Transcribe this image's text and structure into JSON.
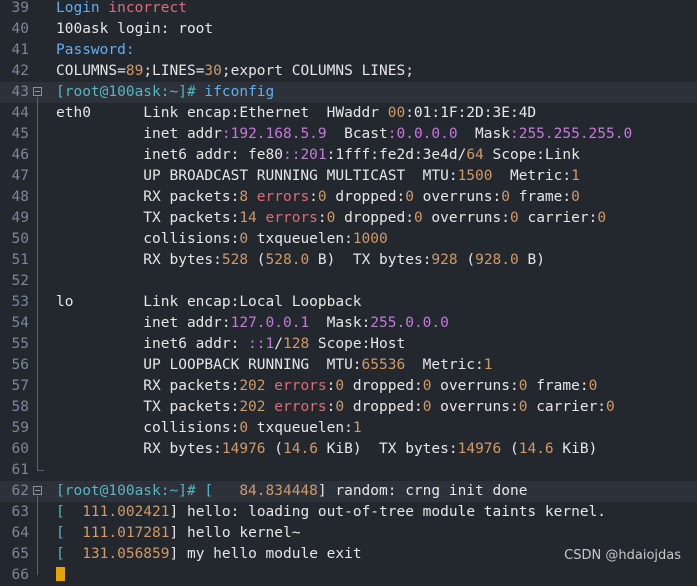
{
  "watermark": "CSDN @hdaiojdas",
  "lines": [
    {
      "n": "39",
      "fold": false,
      "hl": false,
      "segs": [
        [
          "Login ",
          "cyan"
        ],
        [
          "incorrect",
          "red"
        ]
      ]
    },
    {
      "n": "40",
      "fold": false,
      "hl": false,
      "segs": [
        [
          "100ask ",
          ""
        ],
        [
          "login",
          ""
        ],
        [
          ": root",
          ""
        ]
      ]
    },
    {
      "n": "41",
      "fold": false,
      "hl": false,
      "segs": [
        [
          "Password:",
          "cyan"
        ]
      ]
    },
    {
      "n": "42",
      "fold": false,
      "hl": false,
      "segs": [
        [
          "COLUMNS=",
          ""
        ],
        [
          "89",
          "orange"
        ],
        [
          ";LINES=",
          ""
        ],
        [
          "30",
          "orange"
        ],
        [
          ";export COLUMNS LINES;",
          ""
        ]
      ]
    },
    {
      "n": "43",
      "fold": true,
      "hl": true,
      "segs": [
        [
          "[root@100ask:~]#",
          "prompt"
        ],
        [
          " ifconfig",
          "cyan"
        ]
      ]
    },
    {
      "n": "44",
      "fold": false,
      "hl": false,
      "segs": [
        [
          "eth0      Link encap:Ethernet  HWaddr ",
          ""
        ],
        [
          "00",
          "orange"
        ],
        [
          ":01:1F:2D:3E:4D",
          ""
        ]
      ]
    },
    {
      "n": "45",
      "fold": false,
      "hl": false,
      "segs": [
        [
          "          inet addr",
          ""
        ],
        [
          ":192.168.5.9",
          "purple"
        ],
        [
          "  Bcast",
          ""
        ],
        [
          ":0.0.0.0",
          "purple"
        ],
        [
          "  Mask",
          ""
        ],
        [
          ":255.255.255.0",
          "purple"
        ]
      ]
    },
    {
      "n": "46",
      "fold": false,
      "hl": false,
      "segs": [
        [
          "          inet6 addr: fe80",
          ""
        ],
        [
          "::201",
          "purple"
        ],
        [
          ":1fff:fe2d:3e4d/",
          ""
        ],
        [
          "64",
          "orange"
        ],
        [
          " Scope:Link",
          ""
        ]
      ]
    },
    {
      "n": "47",
      "fold": false,
      "hl": false,
      "segs": [
        [
          "          UP BROADCAST RUNNING MULTICAST  MTU:",
          ""
        ],
        [
          "1500",
          "orange"
        ],
        [
          "  Metric:",
          ""
        ],
        [
          "1",
          "orange"
        ]
      ]
    },
    {
      "n": "48",
      "fold": false,
      "hl": false,
      "segs": [
        [
          "          RX packets:",
          ""
        ],
        [
          "8",
          "orange"
        ],
        [
          " errors",
          "red"
        ],
        [
          ":",
          ""
        ],
        [
          "0",
          "orange"
        ],
        [
          " dropped:",
          ""
        ],
        [
          "0",
          "orange"
        ],
        [
          " overruns:",
          ""
        ],
        [
          "0",
          "orange"
        ],
        [
          " frame:",
          ""
        ],
        [
          "0",
          "orange"
        ]
      ]
    },
    {
      "n": "49",
      "fold": false,
      "hl": false,
      "segs": [
        [
          "          TX packets:",
          ""
        ],
        [
          "14",
          "orange"
        ],
        [
          " errors",
          "red"
        ],
        [
          ":",
          ""
        ],
        [
          "0",
          "orange"
        ],
        [
          " dropped:",
          ""
        ],
        [
          "0",
          "orange"
        ],
        [
          " overruns:",
          ""
        ],
        [
          "0",
          "orange"
        ],
        [
          " carrier:",
          ""
        ],
        [
          "0",
          "orange"
        ]
      ]
    },
    {
      "n": "50",
      "fold": false,
      "hl": false,
      "segs": [
        [
          "          collisions:",
          ""
        ],
        [
          "0",
          "orange"
        ],
        [
          " txqueuelen:",
          ""
        ],
        [
          "1000",
          "orange"
        ]
      ]
    },
    {
      "n": "51",
      "fold": false,
      "hl": false,
      "segs": [
        [
          "          RX bytes:",
          ""
        ],
        [
          "528",
          "orange"
        ],
        [
          " (",
          ""
        ],
        [
          "528.0",
          "orange"
        ],
        [
          " B)  TX bytes:",
          ""
        ],
        [
          "928",
          "orange"
        ],
        [
          " (",
          ""
        ],
        [
          "928.0",
          "orange"
        ],
        [
          " B)",
          ""
        ]
      ]
    },
    {
      "n": "52",
      "fold": false,
      "hl": false,
      "segs": []
    },
    {
      "n": "53",
      "fold": false,
      "hl": false,
      "segs": [
        [
          "lo        Link encap:Local Loopback",
          ""
        ]
      ]
    },
    {
      "n": "54",
      "fold": false,
      "hl": false,
      "segs": [
        [
          "          inet addr:",
          ""
        ],
        [
          "127.0.0.1",
          "purple"
        ],
        [
          "  Mask:",
          ""
        ],
        [
          "255.0.0.0",
          "purple"
        ]
      ]
    },
    {
      "n": "55",
      "fold": false,
      "hl": false,
      "segs": [
        [
          "          inet6 addr: ",
          ""
        ],
        [
          "::1",
          "purple"
        ],
        [
          "/",
          ""
        ],
        [
          "128",
          "orange"
        ],
        [
          " Scope:Host",
          ""
        ]
      ]
    },
    {
      "n": "56",
      "fold": false,
      "hl": false,
      "segs": [
        [
          "          UP LOOPBACK RUNNING  MTU:",
          ""
        ],
        [
          "65536",
          "orange"
        ],
        [
          "  Metric:",
          ""
        ],
        [
          "1",
          "orange"
        ]
      ]
    },
    {
      "n": "57",
      "fold": false,
      "hl": false,
      "segs": [
        [
          "          RX packets:",
          ""
        ],
        [
          "202",
          "orange"
        ],
        [
          " errors",
          "red"
        ],
        [
          ":",
          ""
        ],
        [
          "0",
          "orange"
        ],
        [
          " dropped:",
          ""
        ],
        [
          "0",
          "orange"
        ],
        [
          " overruns:",
          ""
        ],
        [
          "0",
          "orange"
        ],
        [
          " frame:",
          ""
        ],
        [
          "0",
          "orange"
        ]
      ]
    },
    {
      "n": "58",
      "fold": false,
      "hl": false,
      "segs": [
        [
          "          TX packets:",
          ""
        ],
        [
          "202",
          "orange"
        ],
        [
          " errors",
          "red"
        ],
        [
          ":",
          ""
        ],
        [
          "0",
          "orange"
        ],
        [
          " dropped:",
          ""
        ],
        [
          "0",
          "orange"
        ],
        [
          " overruns:",
          ""
        ],
        [
          "0",
          "orange"
        ],
        [
          " carrier:",
          ""
        ],
        [
          "0",
          "orange"
        ]
      ]
    },
    {
      "n": "59",
      "fold": false,
      "hl": false,
      "segs": [
        [
          "          collisions:",
          ""
        ],
        [
          "0",
          "orange"
        ],
        [
          " txqueuelen:",
          ""
        ],
        [
          "1",
          "orange"
        ]
      ]
    },
    {
      "n": "60",
      "fold": false,
      "hl": false,
      "segs": [
        [
          "          RX bytes:",
          ""
        ],
        [
          "14976",
          "orange"
        ],
        [
          " (",
          ""
        ],
        [
          "14.6",
          "orange"
        ],
        [
          " KiB)  TX bytes:",
          ""
        ],
        [
          "14976",
          "orange"
        ],
        [
          " (",
          ""
        ],
        [
          "14.6",
          "orange"
        ],
        [
          " KiB)",
          ""
        ]
      ]
    },
    {
      "n": "61",
      "fold": false,
      "hl": false,
      "segs": []
    },
    {
      "n": "62",
      "fold": true,
      "hl": true,
      "segs": [
        [
          "[root@100ask:~]# [   ",
          "prompt"
        ],
        [
          "84.834448",
          "orange"
        ],
        [
          "] random: crng init done",
          ""
        ]
      ]
    },
    {
      "n": "63",
      "fold": false,
      "hl": false,
      "segs": [
        [
          "[  ",
          "prompt"
        ],
        [
          "111.002421",
          "orange"
        ],
        [
          "] hello: loading out-of-tree module taints kernel.",
          ""
        ]
      ]
    },
    {
      "n": "64",
      "fold": false,
      "hl": false,
      "segs": [
        [
          "[  ",
          "prompt"
        ],
        [
          "111.017281",
          "orange"
        ],
        [
          "] hello kernel~",
          ""
        ]
      ]
    },
    {
      "n": "65",
      "fold": false,
      "hl": false,
      "segs": [
        [
          "[  ",
          "prompt"
        ],
        [
          "131.056859",
          "orange"
        ],
        [
          "] my hello module exit",
          ""
        ]
      ]
    },
    {
      "n": "66",
      "fold": false,
      "hl": false,
      "segs": [],
      "caret": true
    }
  ]
}
